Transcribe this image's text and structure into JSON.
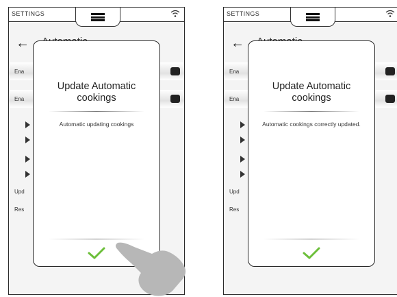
{
  "theme": {
    "check_color": "#6cbf3a",
    "hand_color": "#b7b7b7"
  },
  "screens": [
    {
      "status": {
        "label": "SETTINGS"
      },
      "header": {
        "title": "Automatic"
      },
      "rows": [
        "Ena",
        "Ena"
      ],
      "extra_rows": [
        "Upd",
        "Res"
      ],
      "dialog": {
        "title": "Update Automatic cookings",
        "message": "Automatic updating cookings",
        "confirm_icon": "checkmark-icon"
      }
    },
    {
      "status": {
        "label": "SETTINGS"
      },
      "header": {
        "title": "Automatic"
      },
      "rows": [
        "Ena",
        "Ena"
      ],
      "extra_rows": [
        "Upd",
        "Res"
      ],
      "dialog": {
        "title": "Update Automatic cookings",
        "message": "Automatic cookings correctly updated.",
        "confirm_icon": "checkmark-icon"
      }
    }
  ]
}
